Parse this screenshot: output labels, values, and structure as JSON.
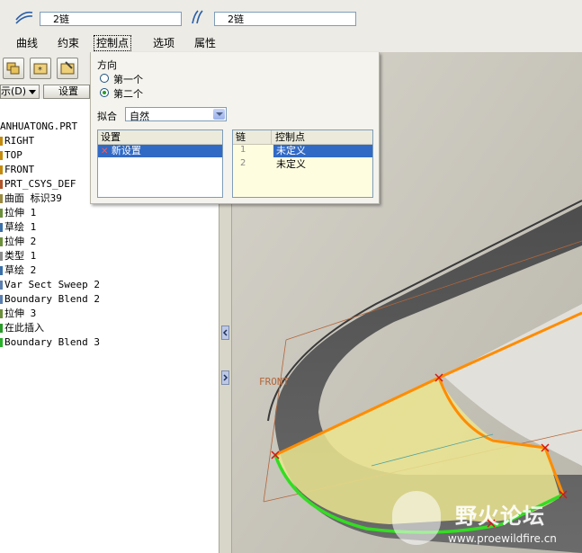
{
  "chains": {
    "field1": "2链",
    "field2": "2链"
  },
  "tabs": [
    {
      "label": "曲线"
    },
    {
      "label": "约束"
    },
    {
      "label": "控制点"
    },
    {
      "label": "选项"
    },
    {
      "label": "属性"
    }
  ],
  "panel": {
    "direction_label": "方向",
    "option1": "第一个",
    "option2": "第二个",
    "fit_label": "拟合",
    "fit_value": "自然",
    "settings_header": "设置",
    "settings_item": "新设置",
    "chain_header": "链",
    "ctrl_header": "控制点",
    "rows": [
      {
        "num": "1",
        "value": "未定义"
      },
      {
        "num": "2",
        "value": "未定义"
      }
    ]
  },
  "toolbar": {
    "show_label": "示(D)",
    "settings_label": "设置 (G"
  },
  "tree": {
    "items": [
      "ANHUATONG.PRT",
      "RIGHT",
      "TOP",
      "FRONT",
      "PRT_CSYS_DEF",
      "曲面 标识39",
      "拉伸 1",
      "草绘 1",
      "拉伸 2",
      "类型 1",
      "草绘 2",
      "Var Sect Sweep 2",
      "Boundary Blend 2",
      "拉伸 3",
      "在此插入",
      "Boundary Blend 3"
    ]
  },
  "viewport": {
    "plane_label": "FRONT"
  },
  "watermark": {
    "title": "野火论坛",
    "url": "www.proewildfire.cn"
  },
  "colors": {
    "surface": "#ebe58f",
    "edge": "#ff8c00",
    "boundary": "#33dd22"
  }
}
